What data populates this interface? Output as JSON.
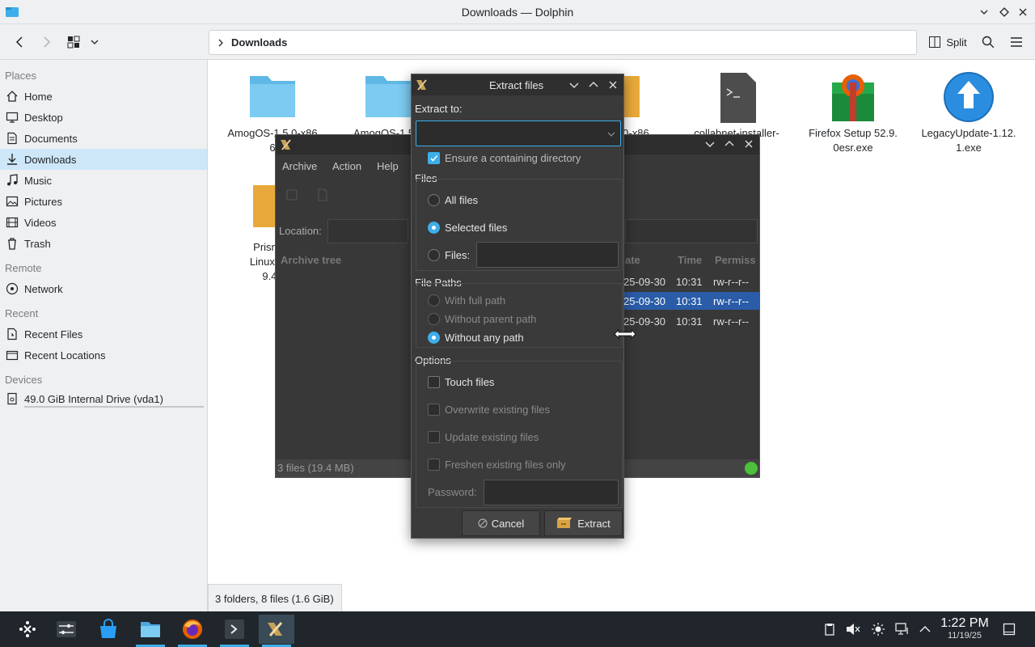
{
  "window": {
    "title": "Downloads — Dolphin"
  },
  "toolbar": {
    "breadcrumb": "Downloads",
    "split_label": "Split"
  },
  "sidebar": {
    "places_label": "Places",
    "places": [
      "Home",
      "Desktop",
      "Documents",
      "Downloads",
      "Music",
      "Pictures",
      "Videos",
      "Trash"
    ],
    "remote_label": "Remote",
    "remote": [
      "Network"
    ],
    "recent_label": "Recent",
    "recent": [
      "Recent Files",
      "Recent Locations"
    ],
    "devices_label": "Devices",
    "devices": [
      "49.0 GiB Internal Drive (vda1)"
    ]
  },
  "files": [
    {
      "line1": "AmogOS-1.5.0-x86",
      "line2": "6"
    },
    {
      "line1": "AmogOS-1.5.0",
      "line2": ""
    },
    {
      "line1": "5.0-x86",
      "line2": ""
    },
    {
      "line1": "collabnet-installer-",
      "line2": ""
    },
    {
      "line1": "Firefox Setup 52.9.",
      "line2": "0esr.exe"
    },
    {
      "line1": "LegacyUpdate-1.12.",
      "line2": "1.exe"
    },
    {
      "line1": "PrismLa",
      "line2": "Linux-Qt6",
      "line3": "9.4.t"
    }
  ],
  "statusbar": {
    "text": "3 folders, 8 files (1.6 GiB)"
  },
  "archiver": {
    "menu": [
      "Archive",
      "Action",
      "Help"
    ],
    "location_label": "Location:",
    "tree_header": "Archive tree",
    "columns": [
      "ate",
      "Time",
      "Permiss"
    ],
    "rows": [
      {
        "date": "25-09-30",
        "time": "10:31",
        "perm": "rw-r--r--"
      },
      {
        "date": "25-09-30",
        "time": "10:31",
        "perm": "rw-r--r--"
      },
      {
        "date": "25-09-30",
        "time": "10:31",
        "perm": "rw-r--r--"
      }
    ],
    "footer": "3 files (19.4 MB)"
  },
  "dialog": {
    "title": "Extract files",
    "extract_to_label": "Extract to:",
    "extract_to_value": "",
    "ensure_dir": "Ensure a containing directory",
    "files_label": "Files",
    "all_files": "All files",
    "selected_files": "Selected files",
    "files_opt": "Files:",
    "paths_label": "File Paths",
    "full_path": "With full path",
    "without_parent": "Without parent path",
    "without_any": "Without any path",
    "options_label": "Options",
    "touch": "Touch files",
    "overwrite": "Overwrite existing files",
    "update": "Update existing files",
    "freshen": "Freshen existing files only",
    "password_label": "Password:",
    "cancel": "Cancel",
    "extract": "Extract"
  },
  "clock": {
    "time": "1:22 PM",
    "date": "11/19/25"
  },
  "colors": {
    "accent": "#3daee9",
    "sidebar_active": "#cde7f8",
    "folder": "#5fb8e6",
    "dark_bg": "#383838",
    "taskbar": "#20262b"
  }
}
